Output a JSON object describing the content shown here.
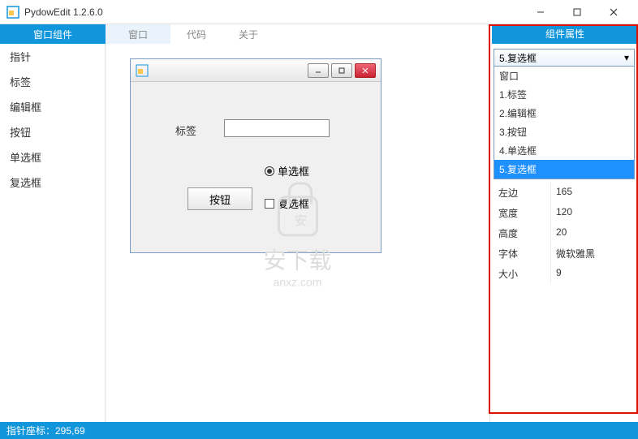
{
  "window": {
    "title": "PydowEdit 1.2.6.0"
  },
  "menubar": {
    "tabs": [
      "窗口组件",
      "窗口",
      "代码",
      "关于"
    ],
    "active_index": 0,
    "right_tab": "组件属性"
  },
  "sidebar": {
    "items": [
      "指针",
      "标签",
      "编辑框",
      "按钮",
      "单选框",
      "复选框"
    ]
  },
  "preview": {
    "label_text": "标签",
    "radio_text": "单选框",
    "button_text": "按钮",
    "checkbox_text": "复选框"
  },
  "watermark": {
    "main": "安下载",
    "sub": "anxz.com"
  },
  "props": {
    "selected": "5.复选框",
    "dropdown_options": [
      "窗口",
      "1.标签",
      "2.编辑框",
      "3.按钮",
      "4.单选框",
      "5.复选框"
    ],
    "rows": [
      {
        "key": "左边",
        "value": "165"
      },
      {
        "key": "宽度",
        "value": "120"
      },
      {
        "key": "高度",
        "value": "20"
      },
      {
        "key": "字体",
        "value": "微软雅黑"
      },
      {
        "key": "大小",
        "value": "9"
      }
    ]
  },
  "statusbar": {
    "text": "指针座标：295,69"
  }
}
